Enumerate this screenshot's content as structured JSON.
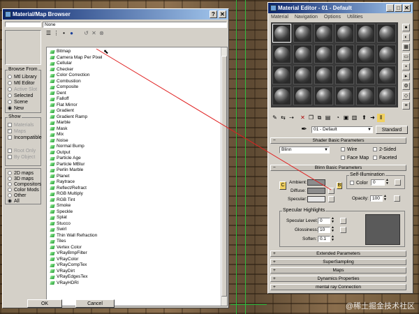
{
  "browser": {
    "title": "Material/Map Browser",
    "help_label": "?",
    "close_label": "✕",
    "name_field": "None",
    "browse_from": {
      "label": "Browse From",
      "options": [
        "Mtl Library",
        "Mtl Editor",
        "Active Slot",
        "Selected",
        "Scene",
        "New"
      ],
      "selected": "New"
    },
    "show": {
      "label": "Show",
      "items": [
        "Materials",
        "Maps",
        "Incompatible"
      ],
      "sub_items": [
        "Root Only",
        "By Object"
      ]
    },
    "categories": [
      "2D maps",
      "3D maps",
      "Compositors",
      "Color Mods",
      "Other",
      "All"
    ],
    "selected_category": "All",
    "maps": [
      "Bitmap",
      "Camera Map Per Pixel",
      "Cellular",
      "Checker",
      "Color Correction",
      "Combustion",
      "Composite",
      "Dent",
      "Falloff",
      "Flat Mirror",
      "Gradient",
      "Gradient Ramp",
      "Marble",
      "Mask",
      "Mix",
      "Noise",
      "Normal Bump",
      "Output",
      "Particle Age",
      "Particle MBlur",
      "Perlin Marble",
      "Planet",
      "Raytrace",
      "Reflect/Refract",
      "RGB Multiply",
      "RGB Tint",
      "Smoke",
      "Speckle",
      "Splat",
      "Stucco",
      "Swirl",
      "Thin Wall Refraction",
      "Tiles",
      "Vertex Color",
      "VRayBmpFilter",
      "VRayColor",
      "VRayCompTex",
      "VRayDirt",
      "VRayEdgesTex",
      "VRayHDRI"
    ],
    "ok_label": "OK",
    "cancel_label": "Cancel"
  },
  "editor": {
    "title": "Material Editor - 01 - Default",
    "minimize_label": "_",
    "maximize_label": "□",
    "close_label": "✕",
    "menu": [
      "Material",
      "Navigation",
      "Options",
      "Utilities"
    ],
    "material_name": "01 - Default",
    "material_type": "Standard",
    "shader_basic": {
      "title": "Shader Basic Parameters",
      "shader": "Blinn",
      "wire": "Wire",
      "two_sided": "2-Sided",
      "face_map": "Face Map",
      "faceted": "Faceted"
    },
    "blinn_basic": {
      "title": "Blinn Basic Parameters",
      "lock_left": "C",
      "lock_right": "B",
      "self_illum": "Self-Illumination",
      "color_label": "Color",
      "color_value": "0",
      "ambient": "Ambient:",
      "diffuse": "Diffuse:",
      "specular": "Specular:",
      "opacity_label": "Opacity:",
      "opacity_value": "100"
    },
    "specular_highlights": {
      "title": "Specular Highlights",
      "level_label": "Specular Level:",
      "level_value": "0",
      "glossiness_label": "Glossiness:",
      "glossiness_value": "10",
      "soften_label": "Soften:",
      "soften_value": "0.1"
    },
    "rollouts": [
      "Extended Parameters",
      "SuperSampling",
      "Maps",
      "Dynamics Properties",
      "mental ray Connection"
    ]
  },
  "watermark": "@稀土掘金技术社区",
  "colors": {
    "title_start": "#0a246a",
    "title_end": "#a6caf0",
    "connector_line": "#e02020",
    "ambient_swatch": "#8c8c8c",
    "diffuse_swatch": "#8c8c8c",
    "specular_swatch": "#e6e6e6"
  }
}
